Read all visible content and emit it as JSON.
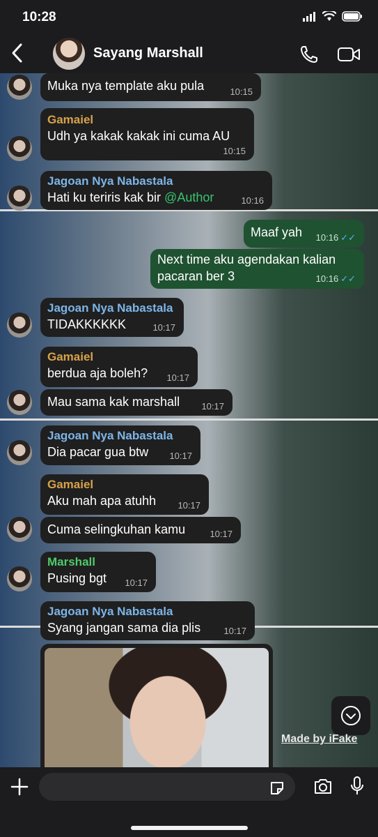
{
  "status_bar": {
    "time": "10:28"
  },
  "header": {
    "title": "Sayang Marshall"
  },
  "messages": [
    {
      "sender": "",
      "text": "Muka nya template aku pula",
      "time": "10:15"
    },
    {
      "sender": "Gamaiel",
      "text": "Udh ya kakak kakak ini cuma AU",
      "time": "10:15"
    },
    {
      "sender": "Jagoan Nya Nabastala",
      "text": "Hati ku teriris kak bir ",
      "mention": "@Author",
      "time": "10:16"
    },
    {
      "sender": "",
      "text": "Maaf yah",
      "time": "10:16",
      "outgoing": true
    },
    {
      "sender": "",
      "text_line1": "Next time aku agendakan kalian",
      "text_line2": "pacaran ber 3",
      "time": "10:16",
      "outgoing": true
    },
    {
      "sender": "Jagoan Nya Nabastala",
      "text": "TIDAKKKKKK",
      "time": "10:17"
    },
    {
      "sender": "Gamaiel",
      "text": "berdua aja boleh?",
      "time": "10:17"
    },
    {
      "sender": "",
      "text": "Mau sama kak marshall",
      "time": "10:17"
    },
    {
      "sender": "Jagoan Nya Nabastala",
      "text": "Dia pacar gua btw",
      "time": "10:17"
    },
    {
      "sender": "Gamaiel",
      "text": "Aku mah apa atuhh",
      "time": "10:17"
    },
    {
      "sender": "",
      "text": "Cuma selingkuhan kamu",
      "time": "10:17"
    },
    {
      "sender": "Marshall",
      "text": "Pusing bgt",
      "time": "10:17"
    },
    {
      "sender": "Jagoan Nya Nabastala",
      "text": "Syang jangan sama dia plis",
      "time": "10:17"
    }
  ],
  "colors": {
    "gamaiel": "#d8a24a",
    "jagoan": "#7db5e8",
    "marshall": "#4ecb6a",
    "outgoing": "#1f5231",
    "incoming": "#1f1f1f"
  },
  "watermark": "Made by iFake",
  "icons": [
    "back-icon",
    "call-icon",
    "video-icon",
    "chevron-down-icon",
    "plus-icon",
    "sticker-icon",
    "camera-icon",
    "mic-icon"
  ]
}
